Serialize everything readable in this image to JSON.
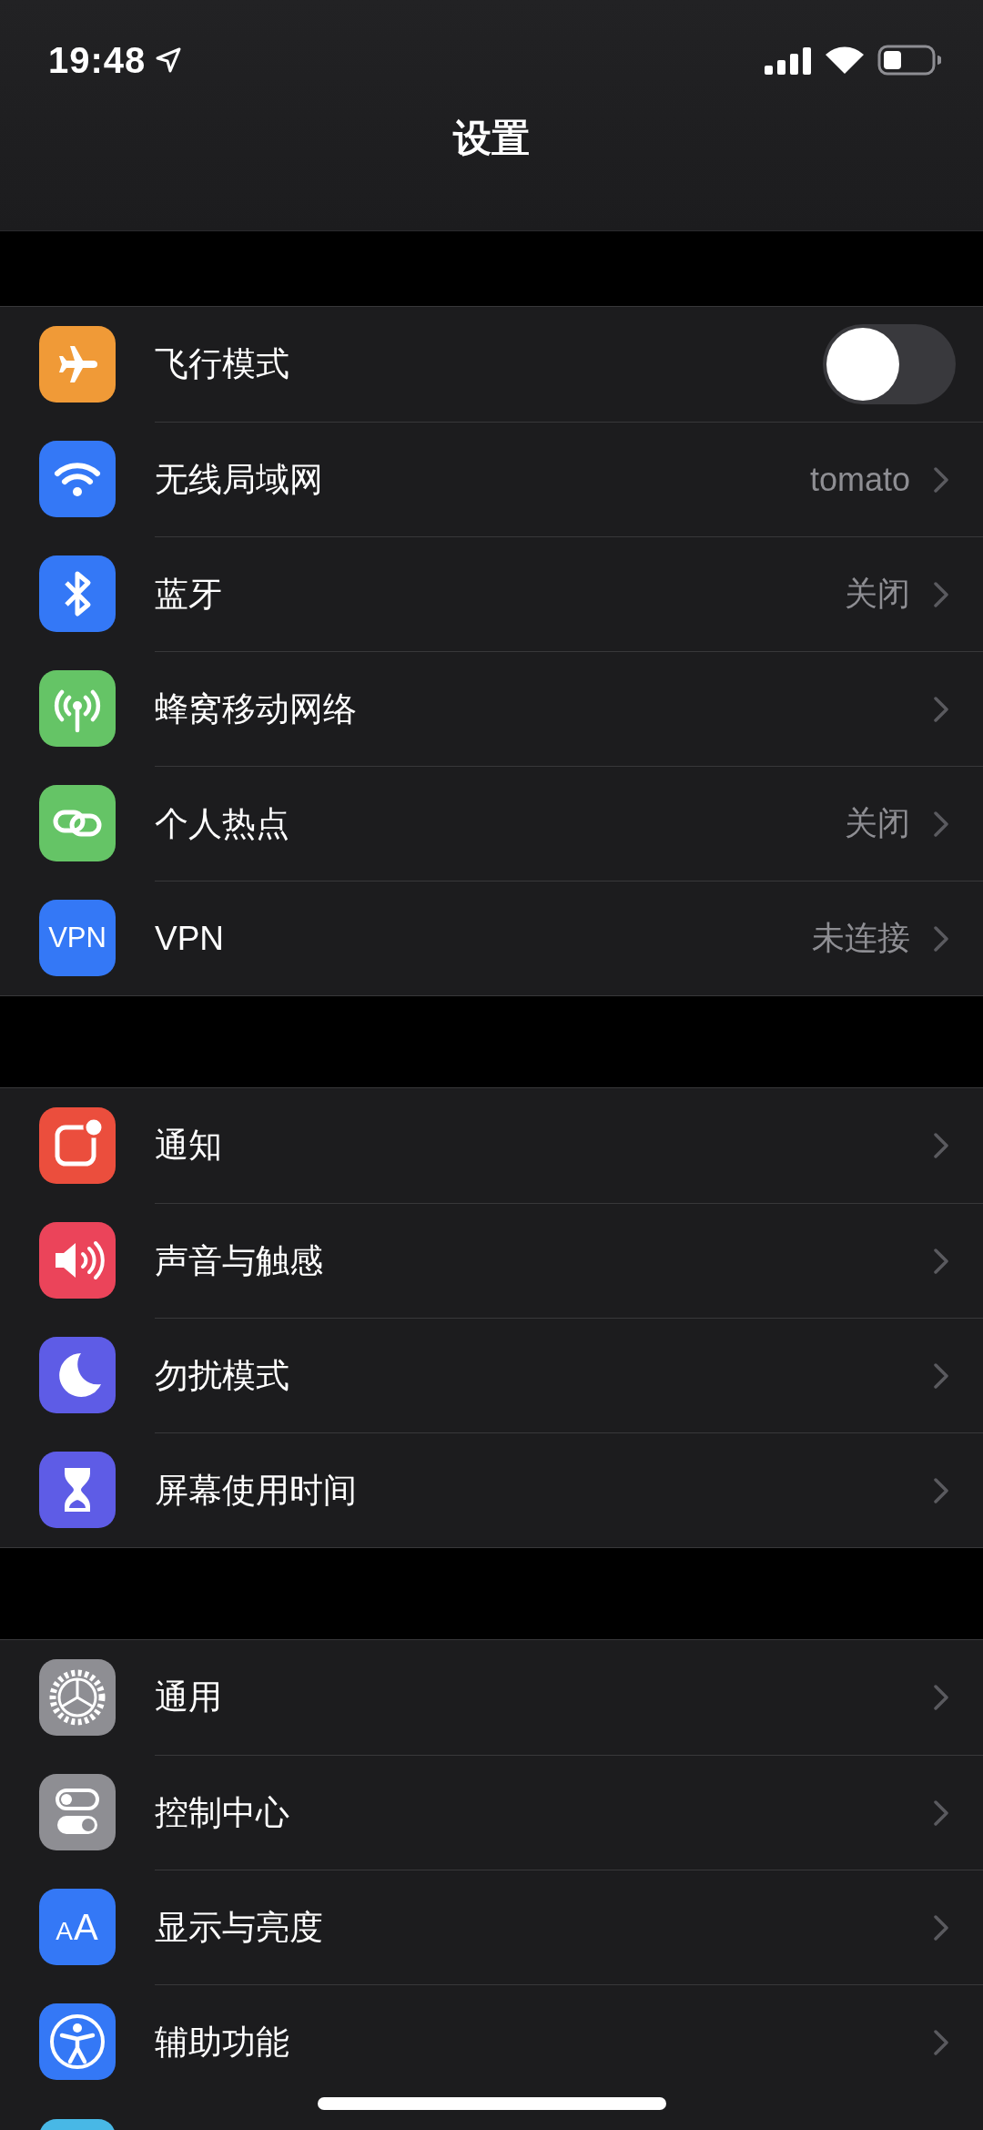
{
  "status_bar": {
    "time": "19:48"
  },
  "nav": {
    "title": "设置"
  },
  "groups": [
    {
      "rows": [
        {
          "kind": "toggle",
          "label": "飞行模式",
          "on": false
        },
        {
          "kind": "link",
          "label": "无线局域网",
          "value": "tomato"
        },
        {
          "kind": "link",
          "label": "蓝牙",
          "value": "关闭"
        },
        {
          "kind": "link",
          "label": "蜂窝移动网络"
        },
        {
          "kind": "link",
          "label": "个人热点",
          "value": "关闭"
        },
        {
          "kind": "link",
          "label": "VPN",
          "value": "未连接",
          "icon_text": "VPN"
        }
      ]
    },
    {
      "rows": [
        {
          "kind": "link",
          "label": "通知"
        },
        {
          "kind": "link",
          "label": "声音与触感"
        },
        {
          "kind": "link",
          "label": "勿扰模式"
        },
        {
          "kind": "link",
          "label": "屏幕使用时间"
        }
      ]
    },
    {
      "rows": [
        {
          "kind": "link",
          "label": "通用"
        },
        {
          "kind": "link",
          "label": "控制中心"
        },
        {
          "kind": "link",
          "label": "显示与亮度",
          "icon_text": "AA"
        },
        {
          "kind": "link",
          "label": "辅助功能"
        },
        {
          "kind": "partial"
        }
      ]
    }
  ]
}
